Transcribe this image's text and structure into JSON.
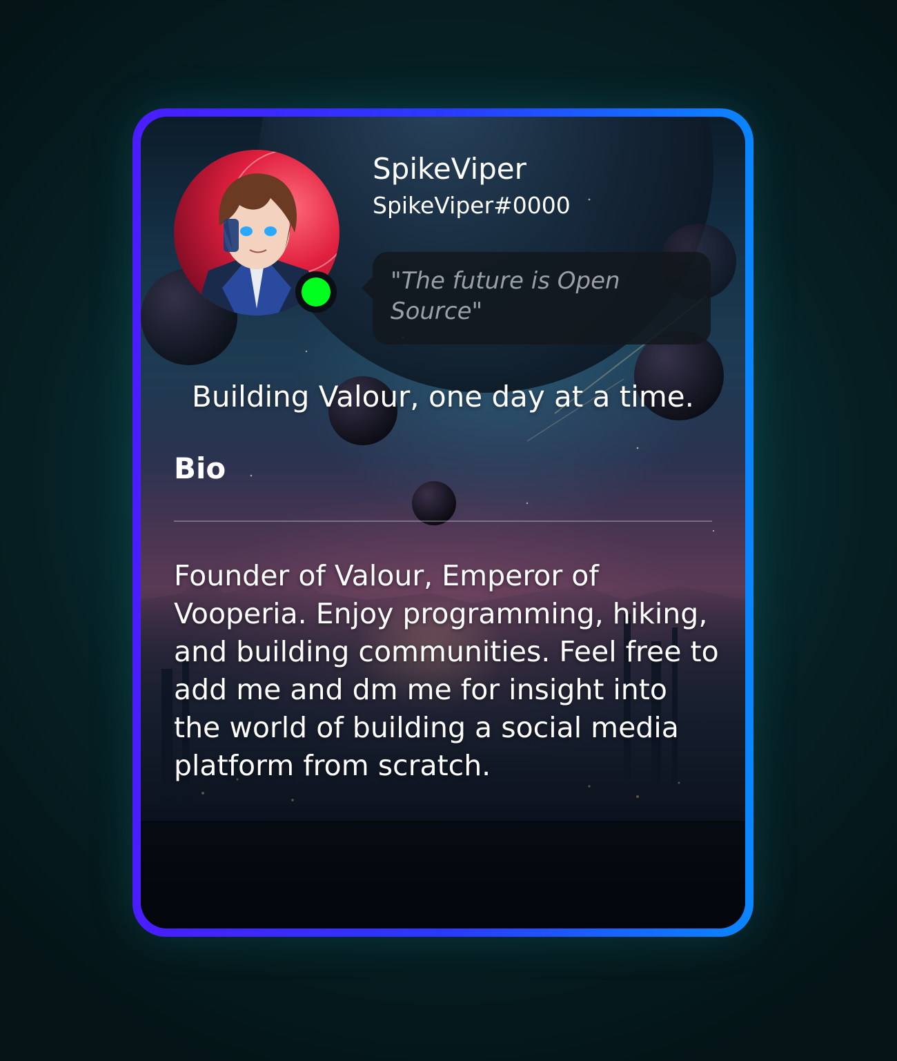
{
  "profile": {
    "display_name": "SpikeViper",
    "tag": "SpikeViper#0000",
    "status": "online",
    "status_quote": "\"The future is Open Source\"",
    "headline": "Building Valour, one day at a time.",
    "bio_heading": "Bio",
    "bio_text": "Founder of Valour, Emperor of Vooperia. Enjoy programming, hiking, and building communities. Feel free to add me and dm me for insight into the world of building a social media platform from scratch."
  },
  "colors": {
    "status_online": "#00ff1f",
    "border_gradient_start": "#4a1dff",
    "border_gradient_end": "#0a86ff",
    "quote_text": "#9aa0a6"
  }
}
